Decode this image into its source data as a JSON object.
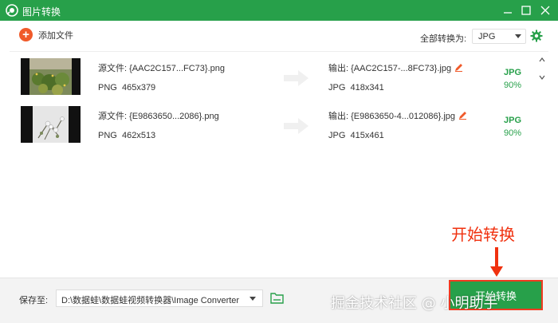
{
  "window": {
    "title": "图片转换"
  },
  "toolbar": {
    "add_file_label": "添加文件",
    "convert_all_label": "全部转换为:",
    "format_value": "JPG"
  },
  "files": [
    {
      "source_label": "源文件:",
      "source_name": "{AAC2C157...FC73}.png",
      "source_format": "PNG",
      "source_dims": "465x379",
      "output_label": "输出:",
      "output_name": "{AAC2C157-...8FC73}.jpg",
      "output_format": "JPG",
      "output_dims": "418x341",
      "badge_format": "JPG",
      "quality": "90%"
    },
    {
      "source_label": "源文件:",
      "source_name": "{E9863650...2086}.png",
      "source_format": "PNG",
      "source_dims": "462x513",
      "output_label": "输出:",
      "output_name": "{E9863650-4...012086}.jpg",
      "output_format": "JPG",
      "output_dims": "415x461",
      "badge_format": "JPG",
      "quality": "90%"
    }
  ],
  "bottom": {
    "save_label": "保存至:",
    "save_path": "D:\\数据蛙\\数据蛙视频转换器\\Image Converter",
    "start_button_label": "开始转换"
  },
  "annotation": {
    "callout_text": "开始转换"
  },
  "watermark": "掘金技术社区 @ 小明助手",
  "colors": {
    "brand_green": "#27a04a",
    "accent_orange": "#f05a2a",
    "annotation_red": "#f0310f"
  }
}
